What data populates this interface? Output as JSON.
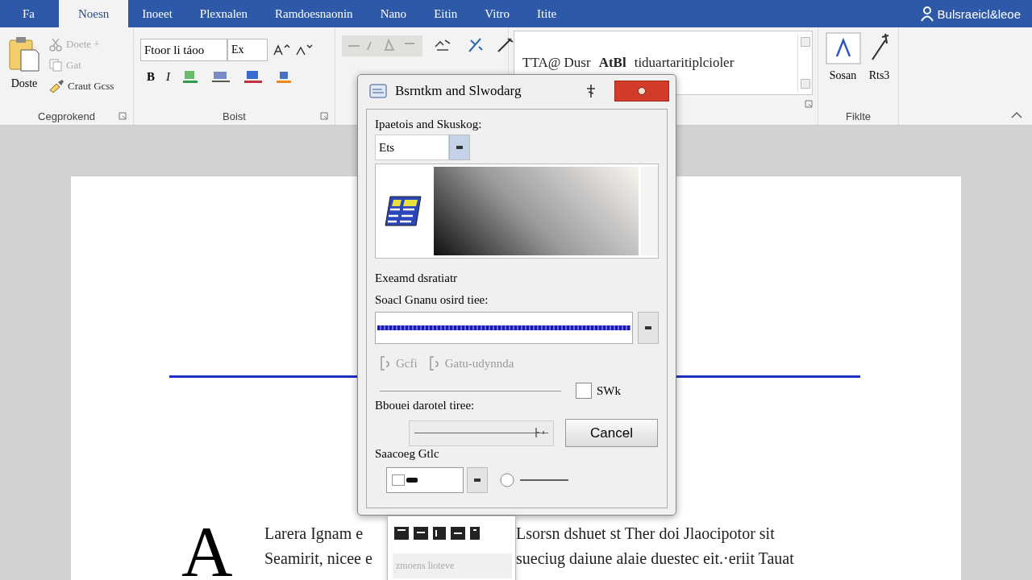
{
  "tabs": [
    {
      "label": "Fa",
      "selected": false
    },
    {
      "label": "Noesn",
      "selected": true
    },
    {
      "label": "Inoeet",
      "selected": false
    },
    {
      "label": "Plexnalen",
      "selected": false
    },
    {
      "label": "Ramdoesnaonin",
      "selected": false
    },
    {
      "label": "Nano",
      "selected": false
    },
    {
      "label": "Eitin",
      "selected": false
    },
    {
      "label": "Vitro",
      "selected": false
    },
    {
      "label": "Itite",
      "selected": false
    }
  ],
  "account": "Bulsraeicl&leoe",
  "ribbon": {
    "clipboard": {
      "paste": "Doste",
      "cut": "Doete +",
      "copy": "Gat",
      "format_painter": "Craut Gcss",
      "label": "Cegprokend"
    },
    "font": {
      "name": "Ftoor li táoo",
      "size": "Ex",
      "format_buttons": [
        "B",
        "I"
      ],
      "label": "Boist"
    },
    "styles": {
      "items": [
        "TTA@ Dusr",
        "AtBl",
        "tiduartaritiplcioler"
      ]
    },
    "editing": {
      "buttons": [
        "Sosan",
        "Rts3"
      ],
      "label": "Fiklte"
    }
  },
  "dialog": {
    "title": "Bsrntkm and Slwodarg",
    "section_label": "Ipaetois and Skuskog:",
    "select_value": "Ets",
    "subheading": "Exeamd dsratiatr",
    "line_label": "Soacl Gnanu osird tiee:",
    "options": [
      "Gcfi",
      "Gatu-udynnda"
    ],
    "checkbox_label": "SWk",
    "checked": false,
    "width_label": "Bbouei darotel tiree:",
    "width_slider": {
      "level": 0.94
    },
    "cancel": "Cancel",
    "spacing_label": "Saacoeg Gtlc"
  },
  "popup": {
    "item": "zmoens lioteve"
  },
  "document": {
    "drop_cap": "A",
    "lines": [
      {
        "left": "Larera Ignam e",
        "right": "Lsorsn dshuet st Ther doi Jlaocipotor sit"
      },
      {
        "left": "Seamirit, nicee e",
        "right": "sueciug daiune alaie duestec eit.·eriit Tauat"
      }
    ]
  }
}
